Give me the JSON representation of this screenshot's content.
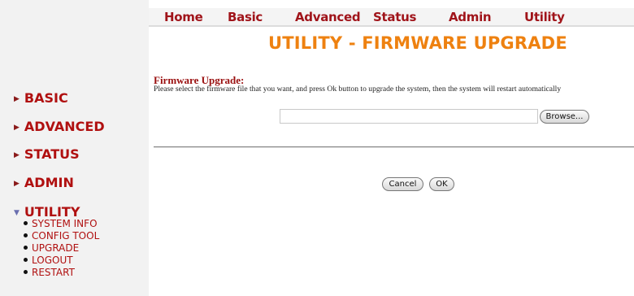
{
  "topnav": {
    "tabs": [
      {
        "label": "Home"
      },
      {
        "label": "Basic"
      },
      {
        "label": "Advanced"
      },
      {
        "label": "Status"
      },
      {
        "label": "Admin"
      },
      {
        "label": "Utility"
      }
    ]
  },
  "sidebar": {
    "items": [
      {
        "label": "BASIC",
        "icon": "triangle-right-icon"
      },
      {
        "label": "ADVANCED",
        "icon": "triangle-right-icon"
      },
      {
        "label": "STATUS",
        "icon": "triangle-right-icon"
      },
      {
        "label": "ADMIN",
        "icon": "triangle-right-icon"
      },
      {
        "label": "UTILITY",
        "icon": "triangle-down-icon"
      }
    ],
    "utility_submenu": [
      {
        "label": "SYSTEM INFO"
      },
      {
        "label": "CONFIG TOOL"
      },
      {
        "label": "UPGRADE"
      },
      {
        "label": "LOGOUT"
      },
      {
        "label": "RESTART"
      }
    ]
  },
  "main": {
    "title": "UTILITY - FIRMWARE UPGRADE",
    "section_title": "Firmware Upgrade:",
    "section_desc": "Please select the firmware file that you want, and press Ok button to upgrade the system, then the system will restart automatically",
    "file_input_value": "",
    "browse_label": "Browse...",
    "cancel_label": "Cancel",
    "ok_label": "OK"
  },
  "colors": {
    "accent_red": "#b01010",
    "title_orange": "#ee8110"
  }
}
